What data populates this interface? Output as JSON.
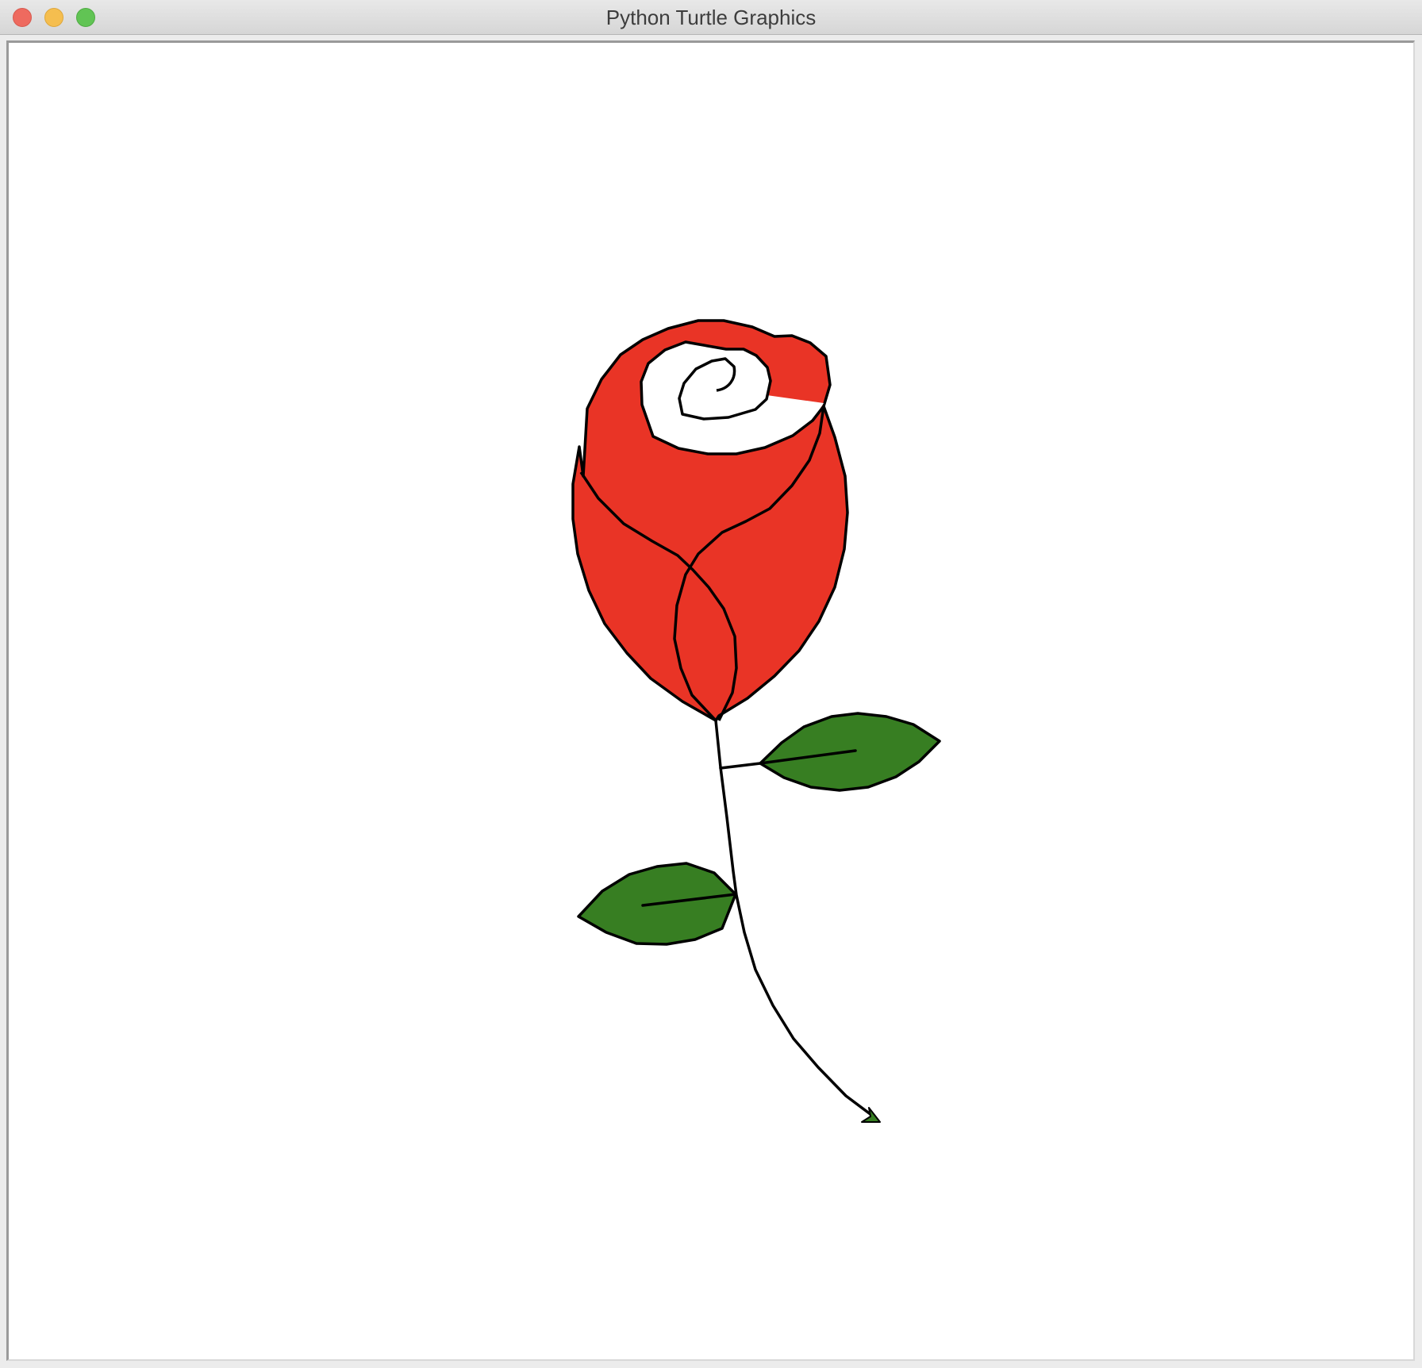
{
  "window": {
    "title": "Python Turtle Graphics",
    "controls": [
      "close",
      "minimize",
      "zoom"
    ]
  },
  "canvas": {
    "background": "#ffffff",
    "drawing": "rose",
    "colors": {
      "petal_fill": "#e93426",
      "leaf_fill": "#377e22",
      "outline": "#000000",
      "turtle_cursor": "#377e22"
    }
  }
}
